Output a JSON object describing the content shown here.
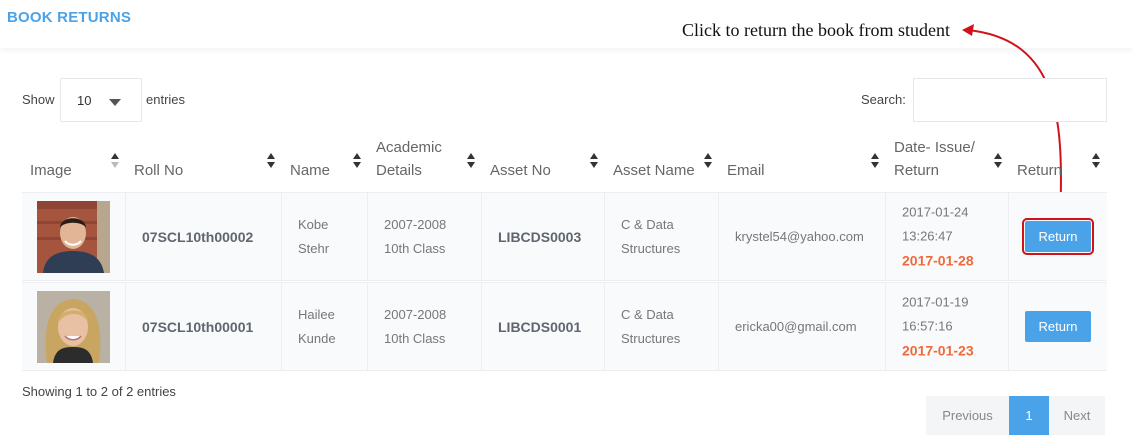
{
  "page_title": "BOOK RETURNS",
  "annotation": "Click to return the book from student",
  "length_menu": {
    "show_label": "Show",
    "value": "10",
    "entries_label": "entries"
  },
  "search": {
    "label": "Search:",
    "value": ""
  },
  "columns": [
    "Image",
    "Roll No",
    "Name",
    "Academic Details",
    "Asset No",
    "Asset Name",
    "Email",
    "Date- Issue/ Return",
    "Return"
  ],
  "columns_wrapped": {
    "academic": [
      "Academic",
      "Details"
    ],
    "date": [
      "Date- Issue/",
      "Return"
    ]
  },
  "rows": [
    {
      "roll_no": "07SCL10th00002",
      "name": [
        "Kobe",
        "Stehr"
      ],
      "academic": [
        "2007-2008",
        "10th Class"
      ],
      "asset_no": "LIBCDS0003",
      "asset_name": [
        "C & Data",
        "Structures"
      ],
      "email": "krystel54@yahoo.com",
      "issue_date": "2017-01-24",
      "issue_time": "13:26:47",
      "return_date": "2017-01-28",
      "button": "Return"
    },
    {
      "roll_no": "07SCL10th00001",
      "name": [
        "Hailee",
        "Kunde"
      ],
      "academic": [
        "2007-2008",
        "10th Class"
      ],
      "asset_no": "LIBCDS0001",
      "asset_name": [
        "C & Data",
        "Structures"
      ],
      "email": "ericka00@gmail.com",
      "issue_date": "2017-01-19",
      "issue_time": "16:57:16",
      "return_date": "2017-01-23",
      "button": "Return"
    }
  ],
  "info": "Showing 1 to 2 of 2 entries",
  "pagination": {
    "previous": "Previous",
    "current": "1",
    "next": "Next"
  },
  "colors": {
    "accent": "#4aa3e8",
    "due_date": "#ee6a3a",
    "annotation_arrow": "#d0121b"
  }
}
